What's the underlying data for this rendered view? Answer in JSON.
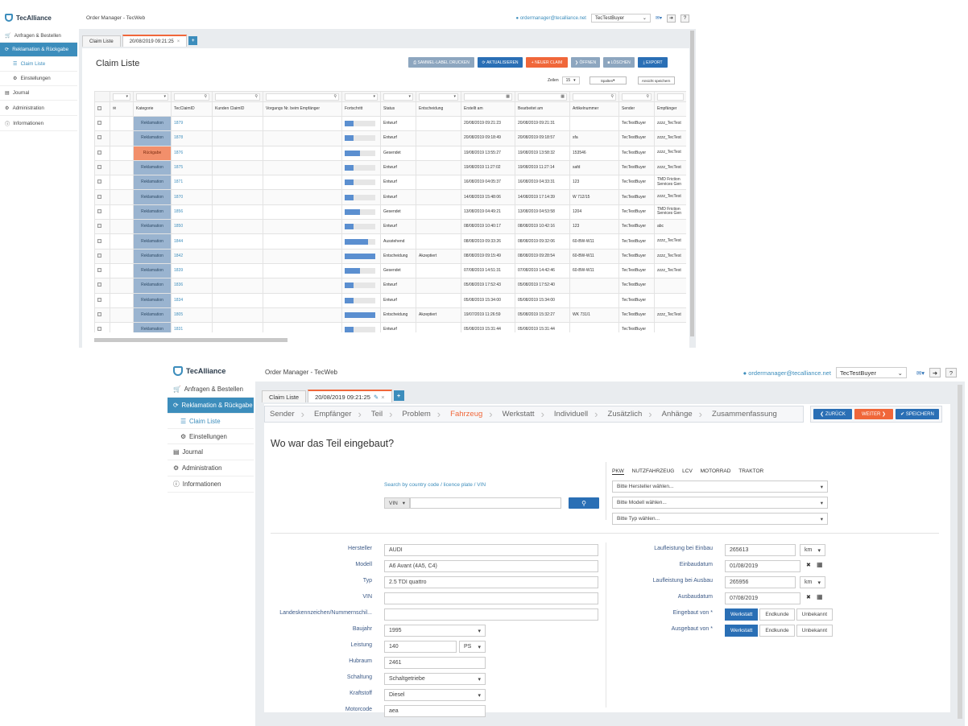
{
  "top": {
    "logo": "TecAlliance",
    "app_title": "Order Manager - TecWeb",
    "user": "ordermanager@tecalliance.net",
    "buyer": "TecTestBuyer",
    "sidebar": [
      {
        "label": "Anfragen & Bestellen",
        "icon": "cart-icon"
      },
      {
        "label": "Reklamation & Rückgabe",
        "icon": "refresh-icon"
      },
      {
        "label": "Claim Liste",
        "icon": "list-icon"
      },
      {
        "label": "Einstellungen",
        "icon": "gears-icon"
      },
      {
        "label": "Journal",
        "icon": "journal-icon"
      },
      {
        "label": "Administration",
        "icon": "gear-icon"
      },
      {
        "label": "Informationen",
        "icon": "info-icon"
      }
    ],
    "tabs": [
      "Claim Liste",
      "20/08/2019 09:21:25"
    ],
    "page_title": "Claim Liste",
    "buttons": [
      "SAMMEL-LABEL DRUCKEN",
      "AKTUALISIEREN",
      "NEUER CLAIM",
      "ÖFFNEN",
      "LÖSCHEN",
      "EXPORT"
    ],
    "zeilen_label": "Zeilen",
    "zeilen_value": "15",
    "spalten_label": "Spalten",
    "ansicht_label": "Ansicht speichern",
    "columns": [
      "Kategorie",
      "TecClaimID",
      "Kunden ClaimID",
      "Vorgangs Nr. beim Empfänger",
      "Fortschritt",
      "Status",
      "Entscheidung",
      "Erstellt am",
      "Bearbeitet am",
      "Artikelnummer",
      "Sender",
      "Empfänger"
    ],
    "rows": [
      {
        "kategorie": "Reklamation",
        "id": "1879",
        "progress": 0.3,
        "status": "Entwurf",
        "entscheidung": "",
        "erstellt": "20/08/2019 09:21:23",
        "bearbeitet": "20/08/2019 09:21:31",
        "artikel": "",
        "sender": "TecTestBuyer",
        "empf": "zzzz_TecTest"
      },
      {
        "kategorie": "Reklamation",
        "id": "1878",
        "progress": 0.3,
        "status": "Entwurf",
        "entscheidung": "",
        "erstellt": "20/08/2019 09:18:49",
        "bearbeitet": "20/08/2019 09:18:57",
        "artikel": "sfa",
        "sender": "TecTestBuyer",
        "empf": "zzzz_TecTest"
      },
      {
        "kategorie": "Rückgabe",
        "id": "1876",
        "progress": 0.5,
        "status": "Gesendet",
        "entscheidung": "",
        "erstellt": "19/08/2019 13:55:27",
        "bearbeitet": "19/08/2019 13:58:32",
        "artikel": "153546",
        "sender": "TecTestBuyer",
        "empf": "zzzz_TecTest"
      },
      {
        "kategorie": "Reklamation",
        "id": "1875",
        "progress": 0.3,
        "status": "Entwurf",
        "entscheidung": "",
        "erstellt": "19/08/2019 11:27:02",
        "bearbeitet": "19/08/2019 11:27:14",
        "artikel": "safd",
        "sender": "TecTestBuyer",
        "empf": "zzzz_TecTest"
      },
      {
        "kategorie": "Reklamation",
        "id": "1871",
        "progress": 0.3,
        "status": "Entwurf",
        "entscheidung": "",
        "erstellt": "16/08/2019 04:05:37",
        "bearbeitet": "16/08/2019 04:33:31",
        "artikel": "123",
        "sender": "TecTestBuyer",
        "empf": "TMD Friction Services Gen"
      },
      {
        "kategorie": "Reklamation",
        "id": "1870",
        "progress": 0.3,
        "status": "Entwurf",
        "entscheidung": "",
        "erstellt": "14/08/2019 15:48:06",
        "bearbeitet": "14/08/2019 17:14:39",
        "artikel": "W 712/15",
        "sender": "TecTestBuyer",
        "empf": "zzzz_TecTest"
      },
      {
        "kategorie": "Reklamation",
        "id": "1856",
        "progress": 0.5,
        "status": "Gesendet",
        "entscheidung": "",
        "erstellt": "13/08/2019 04:49:21",
        "bearbeitet": "13/08/2019 04:53:58",
        "artikel": "1204",
        "sender": "TecTestBuyer",
        "empf": "TMD Friction Services Gen"
      },
      {
        "kategorie": "Reklamation",
        "id": "1850",
        "progress": 0.3,
        "status": "Entwurf",
        "entscheidung": "",
        "erstellt": "08/08/2019 10:40:17",
        "bearbeitet": "08/08/2019 10:42:16",
        "artikel": "123",
        "sender": "TecTestBuyer",
        "empf": "abc"
      },
      {
        "kategorie": "Reklamation",
        "id": "1844",
        "progress": 0.75,
        "status": "Ausstehend",
        "entscheidung": "",
        "erstellt": "08/08/2019 09:33:26",
        "bearbeitet": "08/08/2019 09:32:06",
        "artikel": "60-BW-W11",
        "sender": "TecTestBuyer",
        "empf": "zzzz_TecTest"
      },
      {
        "kategorie": "Reklamation",
        "id": "1842",
        "progress": 1.0,
        "status": "Entscheidung",
        "entscheidung": "Akzeptiert",
        "erstellt": "08/08/2019 09:15:49",
        "bearbeitet": "08/08/2019 09:28:54",
        "artikel": "60-BW-W11",
        "sender": "TecTestBuyer",
        "empf": "zzzz_TecTest"
      },
      {
        "kategorie": "Reklamation",
        "id": "1839",
        "progress": 0.5,
        "status": "Gesendet",
        "entscheidung": "",
        "erstellt": "07/08/2019 14:51:31",
        "bearbeitet": "07/08/2019 14:42:46",
        "artikel": "60-BW-W11",
        "sender": "TecTestBuyer",
        "empf": "zzzz_TecTest"
      },
      {
        "kategorie": "Reklamation",
        "id": "1836",
        "progress": 0.3,
        "status": "Entwurf",
        "entscheidung": "",
        "erstellt": "05/08/2019 17:52:43",
        "bearbeitet": "05/08/2019 17:52:40",
        "artikel": "",
        "sender": "TecTestBuyer",
        "empf": ""
      },
      {
        "kategorie": "Reklamation",
        "id": "1834",
        "progress": 0.3,
        "status": "Entwurf",
        "entscheidung": "",
        "erstellt": "05/08/2019 15:34:00",
        "bearbeitet": "05/08/2019 15:34:00",
        "artikel": "",
        "sender": "TecTestBuyer",
        "empf": ""
      },
      {
        "kategorie": "Reklamation",
        "id": "1805",
        "progress": 1.0,
        "status": "Entscheidung",
        "entscheidung": "Akzeptiert",
        "erstellt": "19/07/2019 11:26:59",
        "bearbeitet": "05/08/2019 15:32:27",
        "artikel": "WK 731/1",
        "sender": "TecTestBuyer",
        "empf": "zzzz_TecTest"
      },
      {
        "kategorie": "Reklamation",
        "id": "1831",
        "progress": 0.3,
        "status": "Entwurf",
        "entscheidung": "",
        "erstellt": "05/08/2019 15:31:44",
        "bearbeitet": "05/08/2019 15:31:44",
        "artikel": "",
        "sender": "TecTestBuyer",
        "empf": ""
      }
    ]
  },
  "bottom": {
    "logo": "TecAlliance",
    "app_title": "Order Manager - TecWeb",
    "user": "ordermanager@tecalliance.net",
    "buyer": "TecTestBuyer",
    "sidebar": [
      {
        "label": "Anfragen & Bestellen",
        "icon": "cart-icon"
      },
      {
        "label": "Reklamation & Rückgabe",
        "icon": "refresh-icon"
      },
      {
        "label": "Claim Liste",
        "icon": "list-icon"
      },
      {
        "label": "Einstellungen",
        "icon": "gears-icon"
      },
      {
        "label": "Journal",
        "icon": "journal-icon"
      },
      {
        "label": "Administration",
        "icon": "gear-icon"
      },
      {
        "label": "Informationen",
        "icon": "info-icon"
      }
    ],
    "tabs": [
      "Claim Liste",
      "20/08/2019 09:21:25"
    ],
    "steps": [
      "Sender",
      "Empfänger",
      "Teil",
      "Problem",
      "Fahrzeug",
      "Werkstatt",
      "Individuell",
      "Zusätzlich",
      "Anhänge",
      "Zusammenfassung"
    ],
    "current_step": "Fahrzeug",
    "btn_back": "ZURÜCK",
    "btn_next": "WEITER",
    "btn_save": "SPEICHERN",
    "question": "Wo war das Teil eingebaut?",
    "search_hint": "Search by country code / licence plate / VIN",
    "search_type": "VIN",
    "vehicle_tabs": [
      "PKW",
      "NUTZFAHRZEUG",
      "LCV",
      "MOTORRAD",
      "TRAKTOR"
    ],
    "hersteller_ph": "Bitte Hersteller wählen...",
    "modell_ph": "Bitte Modell wählen...",
    "typ_ph": "Bitte Typ wählen...",
    "left_fields": {
      "hersteller": {
        "label": "Hersteller",
        "value": "AUDI"
      },
      "modell": {
        "label": "Modell",
        "value": "A6 Avant (4A5, C4)"
      },
      "typ": {
        "label": "Typ",
        "value": "2.5 TDI quattro"
      },
      "vin": {
        "label": "VIN",
        "value": ""
      },
      "kennz": {
        "label": "Landeskennzeichen/Nummernschil...",
        "value": ""
      },
      "baujahr": {
        "label": "Baujahr",
        "value": "1995"
      },
      "leistung": {
        "label": "Leistung",
        "value": "140",
        "unit": "PS"
      },
      "hubraum": {
        "label": "Hubraum",
        "value": "2461"
      },
      "schaltung": {
        "label": "Schaltung",
        "value": "Schaltgetriebe"
      },
      "kraftstoff": {
        "label": "Kraftstoff",
        "value": "Diesel"
      },
      "motorcode": {
        "label": "Motorcode",
        "value": "aea"
      }
    },
    "right_fields": {
      "lf_einbau": {
        "label": "Laufleistung bei Einbau",
        "value": "265613",
        "unit": "km"
      },
      "einbaudatum": {
        "label": "Einbaudatum",
        "value": "01/08/2019"
      },
      "lf_ausbau": {
        "label": "Laufleistung bei Ausbau",
        "value": "265956",
        "unit": "km"
      },
      "ausbaudatum": {
        "label": "Ausbaudatum",
        "value": "07/08/2019"
      },
      "eingebaut": {
        "label": "Eingebaut von *"
      },
      "ausgebaut": {
        "label": "Ausgebaut von *"
      }
    },
    "who_options": [
      "Werkstatt",
      "Endkunde",
      "Unbekannt"
    ]
  },
  "colors": {
    "accent": "#3c8dbc",
    "orange": "#f0673a",
    "dark_blue": "#2a6fb5"
  }
}
